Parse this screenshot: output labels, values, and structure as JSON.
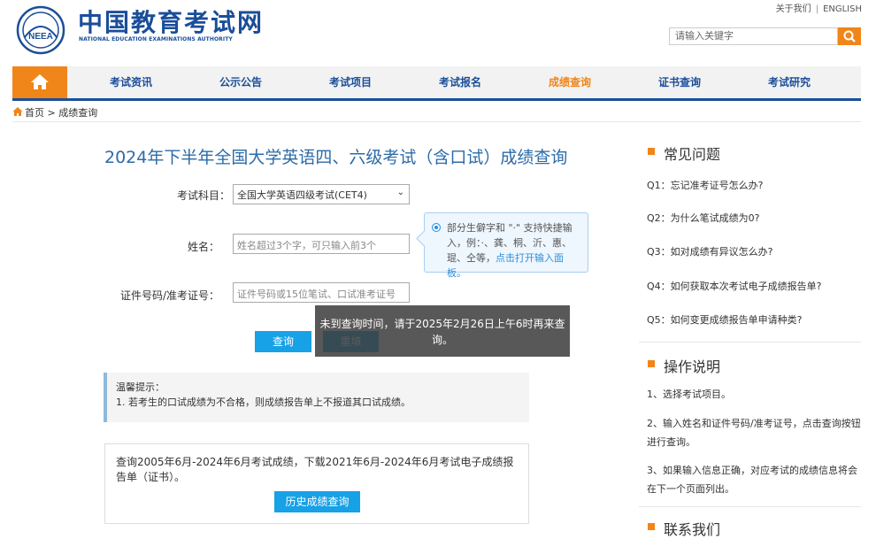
{
  "header": {
    "brand_cn": "中国教育考试网",
    "brand_en": "NATIONAL EDUCATION EXAMINATIONS AUTHORITY",
    "logo_text": "NEEA",
    "top_links": [
      "关于我们",
      "ENGLISH"
    ],
    "search_placeholder": "请输入关键字"
  },
  "nav": {
    "items": [
      "考试资讯",
      "公示公告",
      "考试项目",
      "考试报名",
      "成绩查询",
      "证书查询",
      "考试研究"
    ],
    "active_index": 4
  },
  "breadcrumb": {
    "home": "首页",
    "separator": ">",
    "current": "成绩查询"
  },
  "main": {
    "title": "2024年下半年全国大学英语四、六级考试（含口试）成绩查询",
    "subject_label": "考试科目：",
    "subject_value": "全国大学英语四级考试(CET4)",
    "name_label": "姓名：",
    "name_placeholder": "姓名超过3个字，可只输入前3个",
    "id_label": "证件号码/准考证号：",
    "id_placeholder": "证件号码或15位笔试、口试准考证号",
    "tip_text": "部分生僻字和 \"·\" 支持快捷输入，例：·、龚、桐、沂、惠、琨、仝等，",
    "tip_link": "点击打开输入面板。",
    "query_button": "查询",
    "reset_button": "重填",
    "toast": "未到查询时间，请于2025年2月26日上午6时再来查询。",
    "notice_title": "温馨提示：",
    "notice_line1": "1. 若考生的口试成绩为不合格，则成绩报告单上不报道其口试成绩。",
    "history_text": "查询2005年6月-2024年6月考试成绩，下载2021年6月-2024年6月考试电子成绩报告单（证书）。",
    "history_button": "历史成绩查询"
  },
  "sidebar": {
    "faq_title": "常见问题",
    "faqs": [
      "Q1：忘记准考证号怎么办?",
      "Q2：为什么笔试成绩为0?",
      "Q3：如对成绩有异议怎么办?",
      "Q4：如何获取本次考试电子成绩报告单?",
      "Q5：如何变更成绩报告单申请种类?"
    ],
    "steps_title": "操作说明",
    "steps": [
      "1、选择考试项目。",
      "2、输入姓名和证件号码/准考证号，点击查询按钮进行查询。",
      "3、如果输入信息正确，对应考试的成绩信息将会在下一个页面列出。"
    ],
    "contact_title": "联系我们"
  },
  "colors": {
    "brand_blue": "#1a4e99",
    "accent_orange": "#f08519",
    "button_blue": "#17a1e6"
  }
}
